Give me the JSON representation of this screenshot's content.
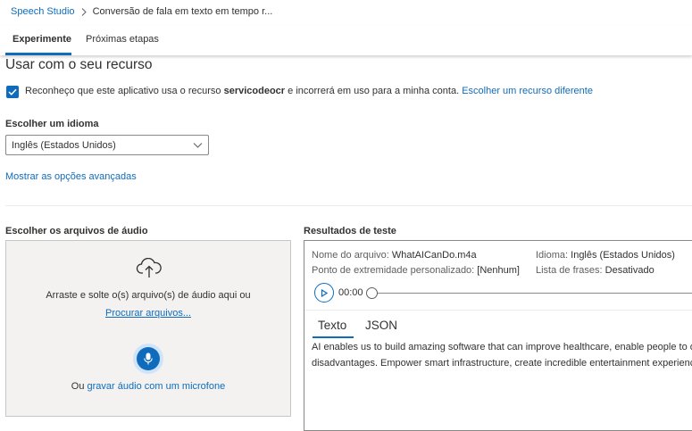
{
  "breadcrumb": {
    "root": "Speech Studio",
    "current": "Conversão de fala em texto em tempo r..."
  },
  "tabs": [
    {
      "label": "Experimente",
      "active": true
    },
    {
      "label": "Próximas etapas",
      "active": false
    }
  ],
  "resource": {
    "title": "Usar com o seu recurso",
    "consent_prefix": "Reconheço que este aplicativo usa o recurso",
    "resource_name": "servicodeocr",
    "consent_suffix": "e incorrerá em uso para a minha conta.",
    "change_link": "Escolher um recurso diferente",
    "checked": true
  },
  "language": {
    "label": "Escolher um idioma",
    "selected": "Inglês (Estados Unidos)",
    "advanced_link": "Mostrar as opções avançadas"
  },
  "audio": {
    "label": "Escolher os arquivos de áudio",
    "drop_text": "Arraste e solte o(s) arquivo(s) de áudio aqui ou",
    "browse_link": "Procurar arquivos...",
    "mic_prefix": "Ou",
    "mic_link": "gravar áudio com um microfone"
  },
  "results": {
    "label": "Resultados de teste",
    "file_label": "Nome do arquivo:",
    "file_value": "WhatAICanDo.m4a",
    "language_label": "Idioma:",
    "language_value": "Inglês (Estados Unidos)",
    "endpoint_label": "Ponto de extremidade personalizado:",
    "endpoint_value": "[Nenhum]",
    "phrases_label": "Lista de frases:",
    "phrases_value": "Desativado",
    "time": "00:00",
    "tabs": [
      {
        "label": "Texto",
        "active": true
      },
      {
        "label": "JSON",
        "active": false
      }
    ],
    "text_lines": [
      "AI enables us to build amazing software that can improve healthcare, enable people to over",
      "disadvantages. Empower smart infrastructure, create incredible entertainment experiences,"
    ]
  },
  "colors": {
    "accent": "#0f6cbd",
    "text": "#323130",
    "muted": "#605e5c",
    "upload_bg": "#f3f2f1"
  },
  "icons": [
    "chevron-right-icon",
    "checkmark-icon",
    "chevron-down-icon",
    "cloud-upload-icon",
    "microphone-icon",
    "play-icon"
  ]
}
